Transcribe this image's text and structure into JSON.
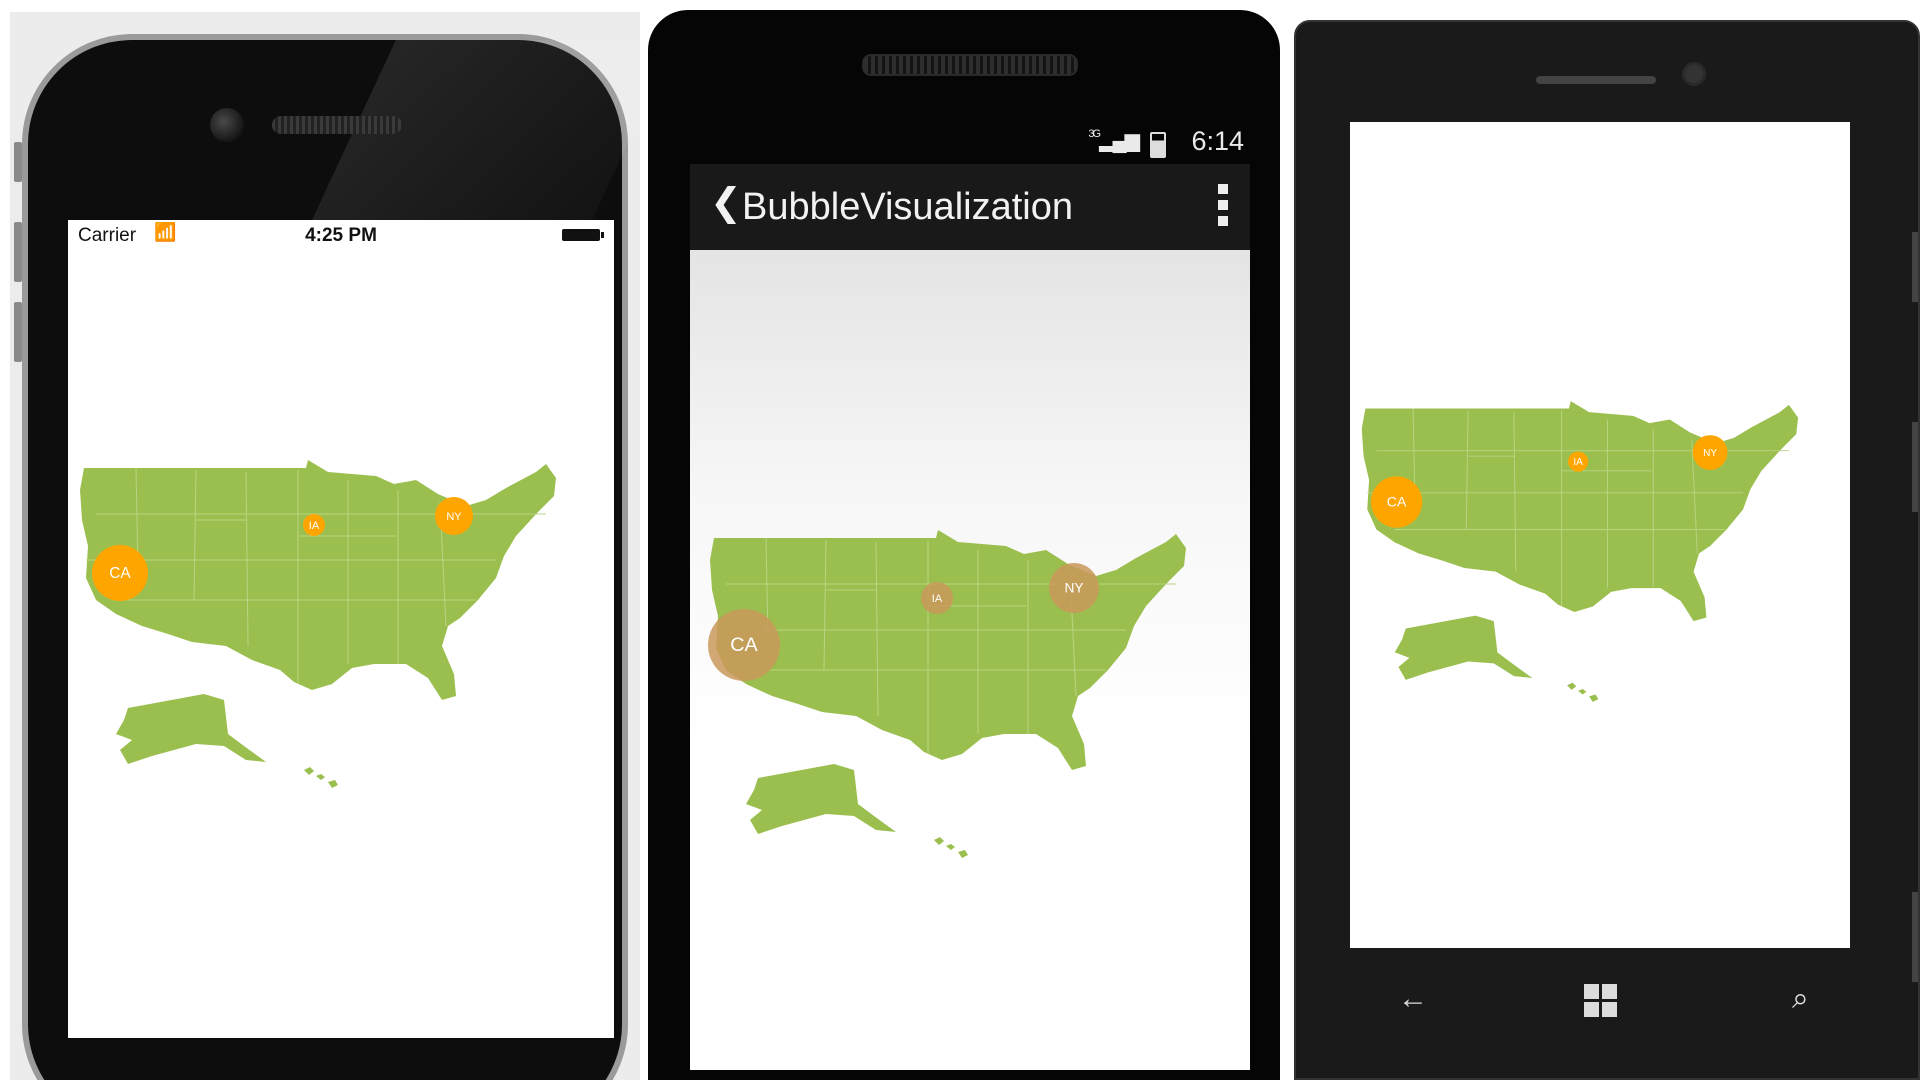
{
  "iphone": {
    "status": {
      "carrier": "Carrier",
      "time": "4:25 PM"
    }
  },
  "android": {
    "status": {
      "time": "6:14",
      "network": "3G"
    },
    "actionbar": {
      "back": "❮",
      "title": "BubbleVisualization"
    }
  },
  "winphone": {
    "nav": {
      "back": "←",
      "search": "⌕"
    }
  },
  "map": {
    "region": "United States",
    "land_color": "#9bbf4e",
    "border_color": "#b9d483",
    "bubbles": [
      {
        "label": "CA",
        "size": 3
      },
      {
        "label": "IA",
        "size": 1
      },
      {
        "label": "NY",
        "size": 2
      }
    ],
    "bubble_color_opaque": "#ffa500",
    "bubble_color_android": "#c9985a"
  }
}
